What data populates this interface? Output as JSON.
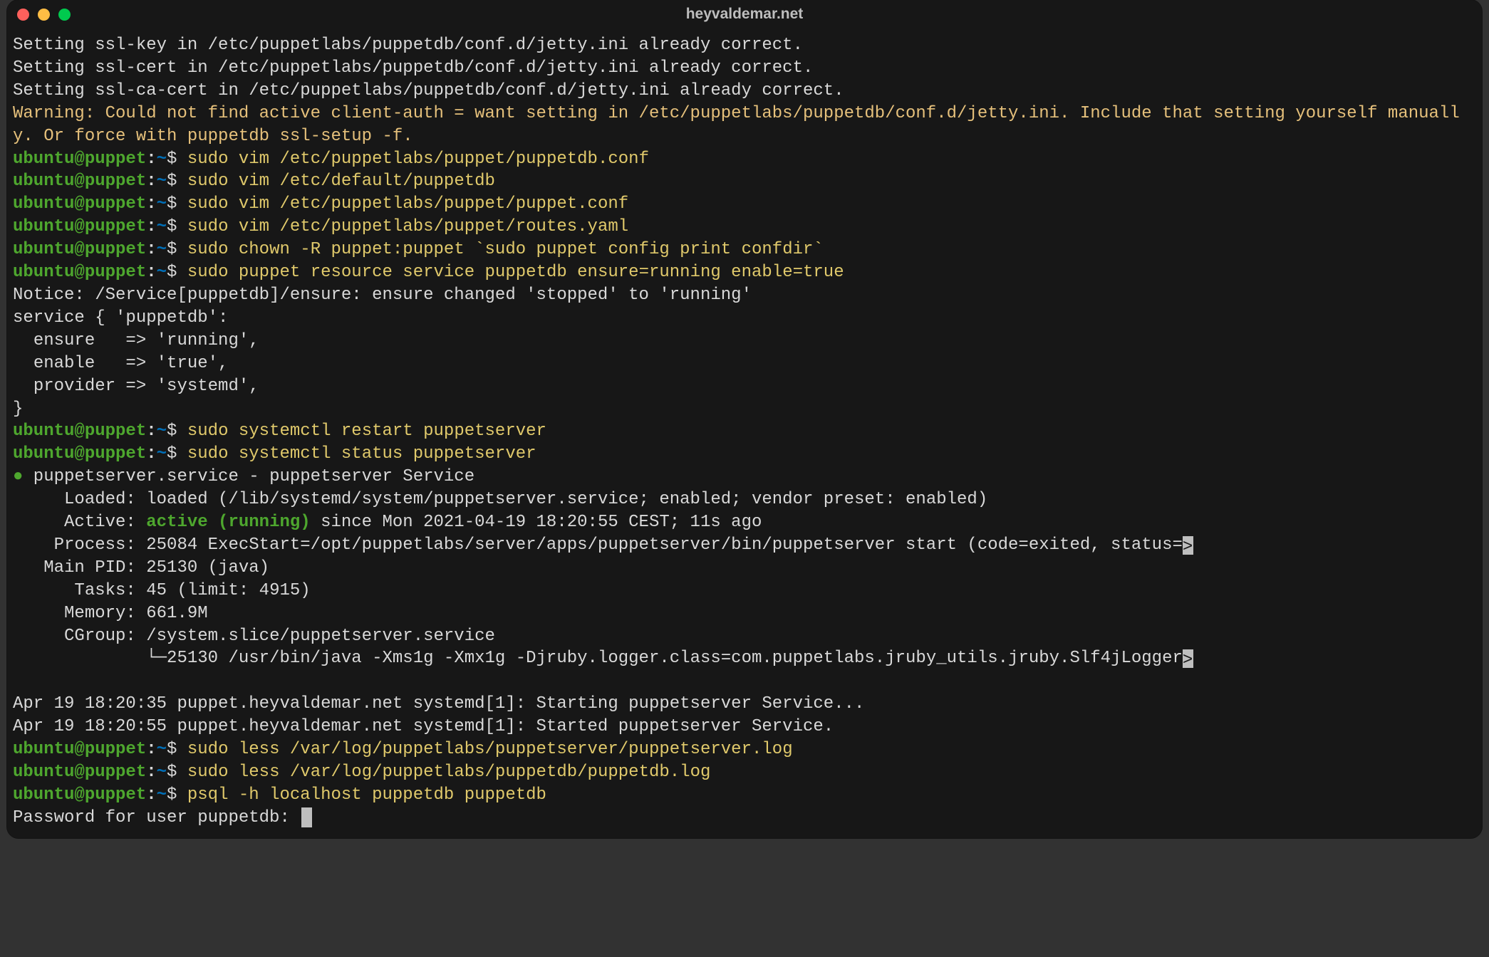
{
  "window": {
    "title": "heyvaldemar.net"
  },
  "prompt": {
    "user": "ubuntu@puppet",
    "sep": ":",
    "path": "~",
    "sign": "$"
  },
  "out": {
    "l1": "Setting ssl-key in /etc/puppetlabs/puppetdb/conf.d/jetty.ini already correct.",
    "l2": "Setting ssl-cert in /etc/puppetlabs/puppetdb/conf.d/jetty.ini already correct.",
    "l3": "Setting ssl-ca-cert in /etc/puppetlabs/puppetdb/conf.d/jetty.ini already correct.",
    "l4": "Warning: Could not find active client-auth = want setting in /etc/puppetlabs/puppetdb/conf.d/jetty.ini. Include that setting yourself manually. Or force with puppetdb ssl-setup -f.",
    "l5": "Notice: /Service[puppetdb]/ensure: ensure changed 'stopped' to 'running'",
    "l6": "service { 'puppetdb':",
    "l7": "  ensure   => 'running',",
    "l8": "  enable   => 'true',",
    "l9": "  provider => 'systemd',",
    "l10": "}",
    "svc_header_a": " puppetserver.service - puppetserver Service",
    "svc_loaded": "     Loaded: loaded (/lib/systemd/system/puppetserver.service; enabled; vendor preset: enabled)",
    "svc_active_a": "     Active: ",
    "svc_active_b": "active (running)",
    "svc_active_c": " since Mon 2021-04-19 18:20:55 CEST; 11s ago",
    "svc_process": "    Process: 25084 ExecStart=/opt/puppetlabs/server/apps/puppetserver/bin/puppetserver start (code=exited, status=",
    "svc_mainpid": "   Main PID: 25130 (java)",
    "svc_tasks": "      Tasks: 45 (limit: 4915)",
    "svc_memory": "     Memory: 661.9M",
    "svc_cgroup": "     CGroup: /system.slice/puppetserver.service",
    "svc_tree_elbow": "             └─",
    "svc_tree_body": "25130 /usr/bin/java -Xms1g -Xmx1g -Djruby.logger.class=com.puppetlabs.jruby_utils.jruby.Slf4jLogger",
    "log1": "Apr 19 18:20:35 puppet.heyvaldemar.net systemd[1]: Starting puppetserver Service...",
    "log2": "Apr 19 18:20:55 puppet.heyvaldemar.net systemd[1]: Started puppetserver Service.",
    "pw_prompt": "Password for user puppetdb: "
  },
  "cmds": {
    "c1": "sudo vim /etc/puppetlabs/puppet/puppetdb.conf",
    "c2": "sudo vim /etc/default/puppetdb",
    "c3": "sudo vim /etc/puppetlabs/puppet/puppet.conf",
    "c4": "sudo vim /etc/puppetlabs/puppet/routes.yaml",
    "c5": "sudo chown -R puppet:puppet `sudo puppet config print confdir`",
    "c6": "sudo puppet resource service puppetdb ensure=running enable=true",
    "c7": "sudo systemctl restart puppetserver",
    "c8": "sudo systemctl status puppetserver",
    "c9": "sudo less /var/log/puppetlabs/puppetserver/puppetserver.log",
    "c10": "sudo less /var/log/puppetlabs/puppetdb/puppetdb.log",
    "c11": "psql -h localhost puppetdb puppetdb"
  },
  "glyph": {
    "bullet": "●",
    "gt": ">"
  }
}
